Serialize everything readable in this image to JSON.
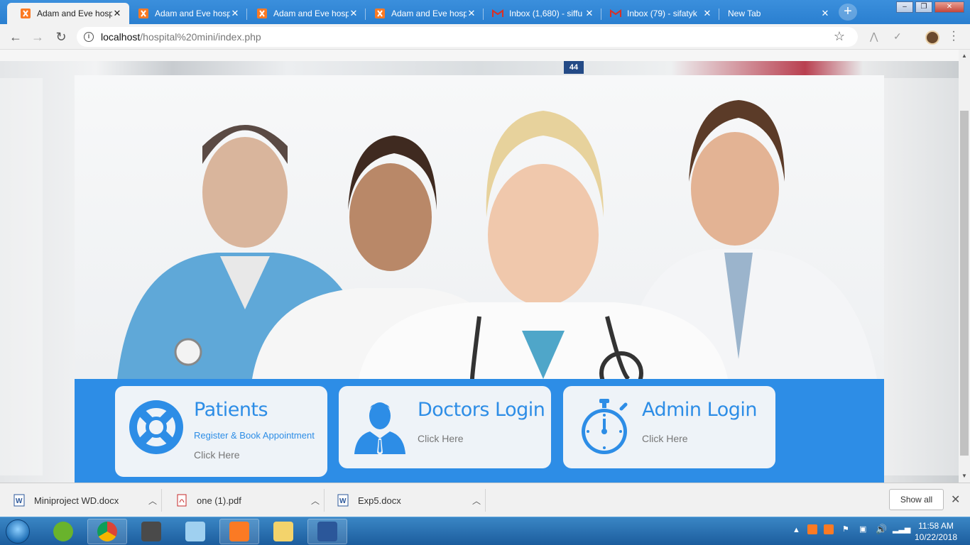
{
  "browser": {
    "tabs": [
      {
        "title": "Adam and Eve hosp",
        "icon": "xampp-icon",
        "active": true
      },
      {
        "title": "Adam and Eve hosp",
        "icon": "xampp-icon",
        "active": false
      },
      {
        "title": "Adam and Eve hosp",
        "icon": "xampp-icon",
        "active": false
      },
      {
        "title": "Adam and Eve hosp",
        "icon": "xampp-icon",
        "active": false
      },
      {
        "title": "Inbox (1,680) - siffu",
        "icon": "gmail-icon",
        "active": false
      },
      {
        "title": "Inbox (79) - sifatyk",
        "icon": "gmail-icon",
        "active": false
      },
      {
        "title": "New Tab",
        "icon": "",
        "active": false
      }
    ],
    "address": {
      "host": "localhost",
      "path": "/hospital%20mini/index.php"
    }
  },
  "page": {
    "room_number": "44",
    "cards": [
      {
        "title": "Patients",
        "subtitle": "Register & Book Appointment",
        "cta": "Click Here",
        "icon": "lifebuoy-icon"
      },
      {
        "title": "Doctors Login",
        "subtitle": "",
        "cta": "Click Here",
        "icon": "doctor-icon"
      },
      {
        "title": "Admin Login",
        "subtitle": "",
        "cta": "Click Here",
        "icon": "stopwatch-icon"
      }
    ],
    "colors": {
      "accent": "#2d8de6",
      "card_bg": "#eef3f8"
    }
  },
  "downloads": {
    "items": [
      {
        "name": "Miniproject WD.docx",
        "type": "word-icon"
      },
      {
        "name": "one (1).pdf",
        "type": "pdf-icon"
      },
      {
        "name": "Exp5.docx",
        "type": "word-icon"
      }
    ],
    "show_all": "Show all"
  },
  "taskbar": {
    "time": "11:58 AM",
    "date": "10/22/2018"
  }
}
